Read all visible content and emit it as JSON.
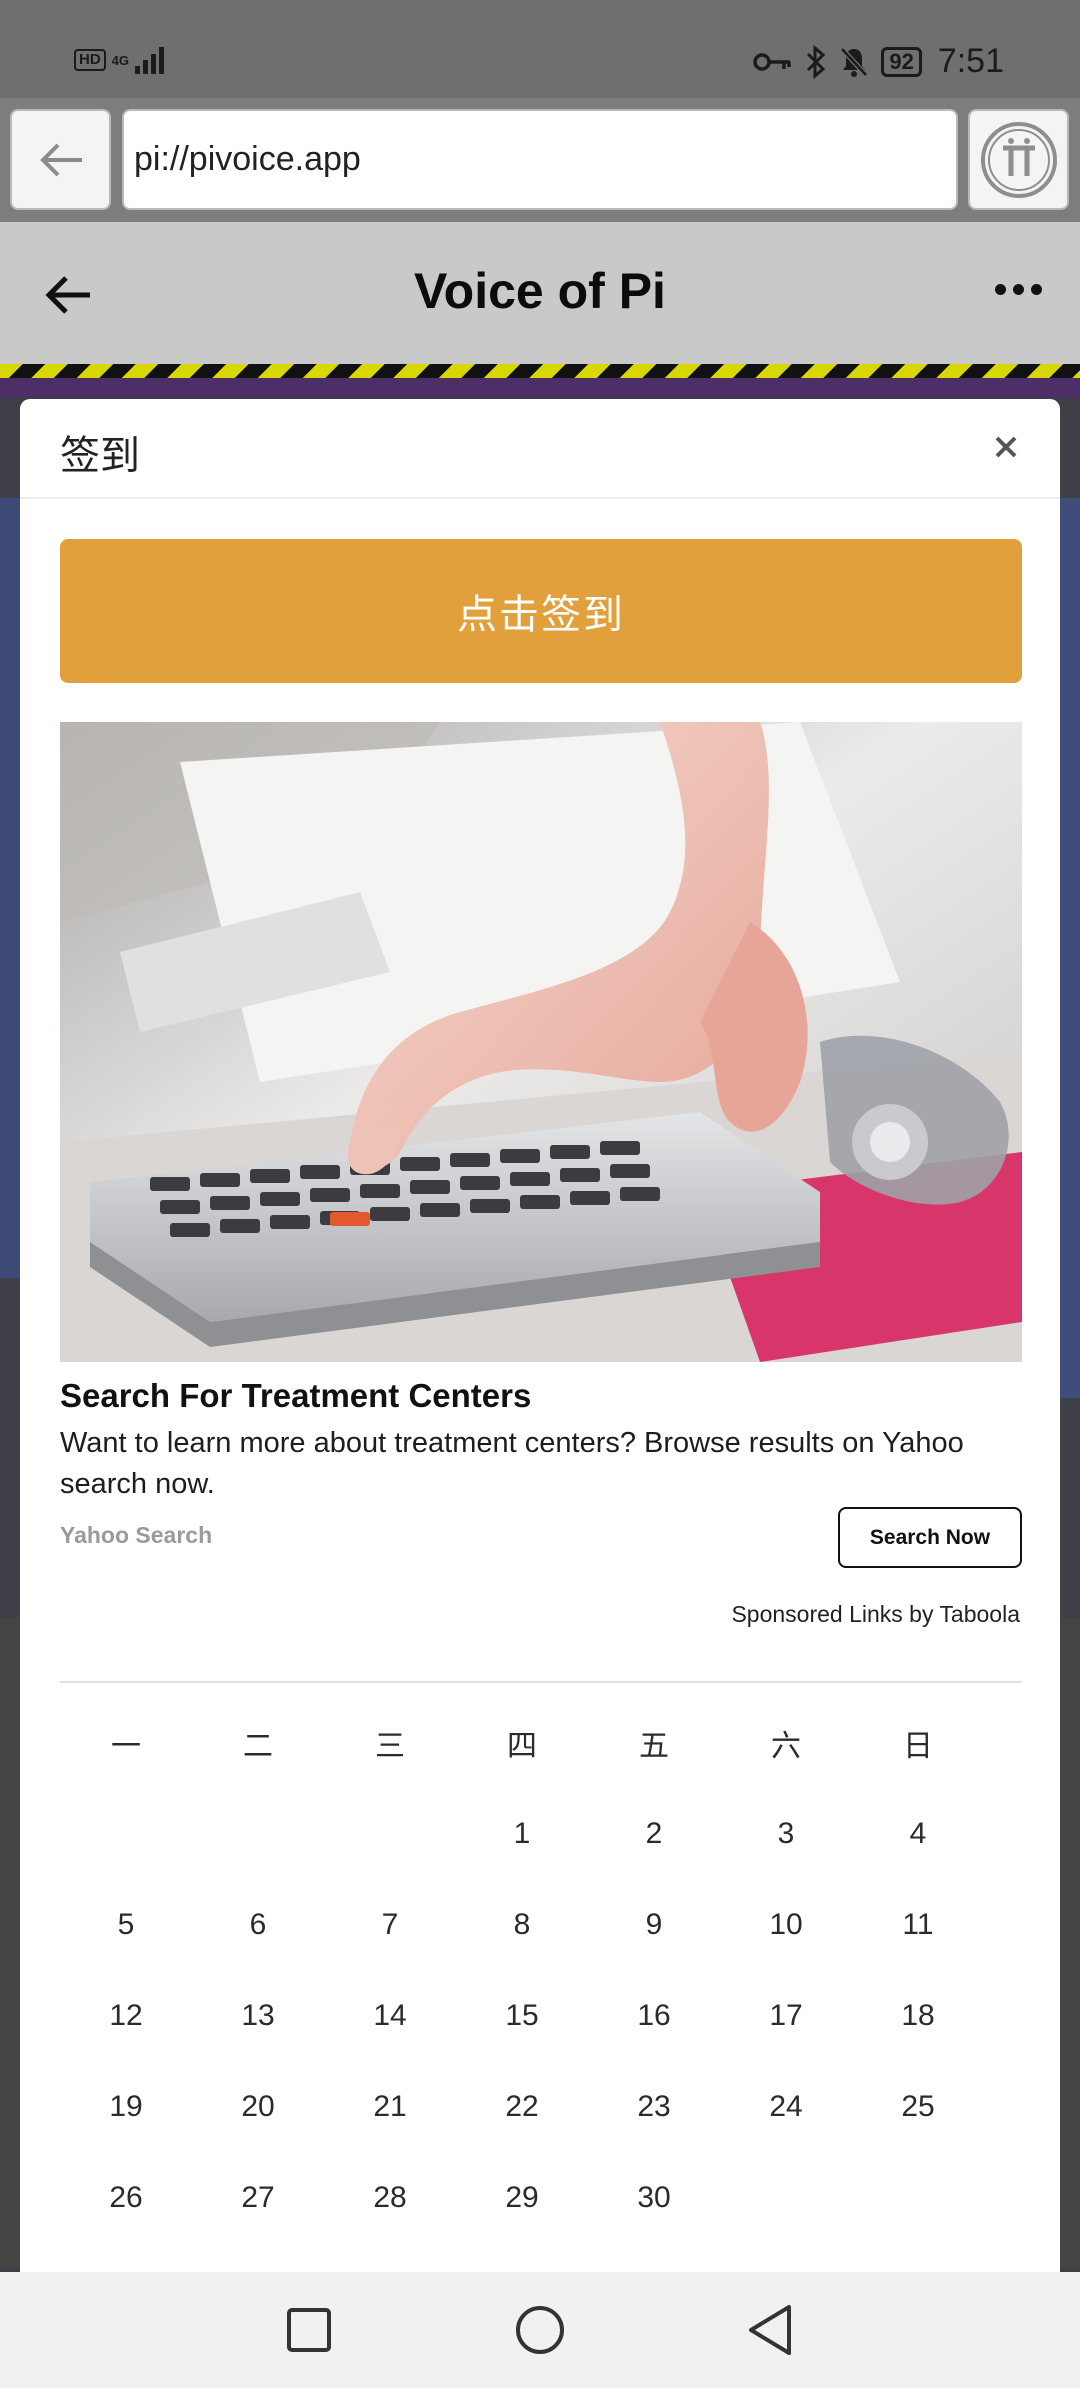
{
  "status_bar": {
    "hd": "HD",
    "network": "4G",
    "battery": "92",
    "time": "7:51"
  },
  "browser": {
    "url": "pi://pivoice.app"
  },
  "app": {
    "title": "Voice of Pi"
  },
  "modal": {
    "title": "签到",
    "checkin_label": "点击签到"
  },
  "ad": {
    "title": "Search For Treatment Centers",
    "description": "Want to learn more about treatment centers? Browse results on Yahoo search now.",
    "source": "Yahoo Search",
    "cta": "Search Now",
    "sponsor": "Sponsored Links by Taboola"
  },
  "calendar": {
    "weekdays": [
      "一",
      "二",
      "三",
      "四",
      "五",
      "六",
      "日"
    ],
    "weeks": [
      [
        "",
        "",
        "",
        "1",
        "2",
        "3",
        "4"
      ],
      [
        "5",
        "6",
        "7",
        "8",
        "9",
        "10",
        "11"
      ],
      [
        "12",
        "13",
        "14",
        "15",
        "16",
        "17",
        "18"
      ],
      [
        "19",
        "20",
        "21",
        "22",
        "23",
        "24",
        "25"
      ],
      [
        "26",
        "27",
        "28",
        "29",
        "30",
        "",
        ""
      ]
    ]
  },
  "colors": {
    "checkin_button": "#e2a03c",
    "hazard_yellow": "#d8d800"
  },
  "icons": {
    "browser_back": "arrow-left-icon",
    "pi_logo": "pi-logo-icon",
    "header_back": "arrow-left-icon",
    "menu": "more-dots-icon",
    "close": "close-icon",
    "nav": [
      "square-icon",
      "circle-icon",
      "triangle-back-icon"
    ]
  }
}
